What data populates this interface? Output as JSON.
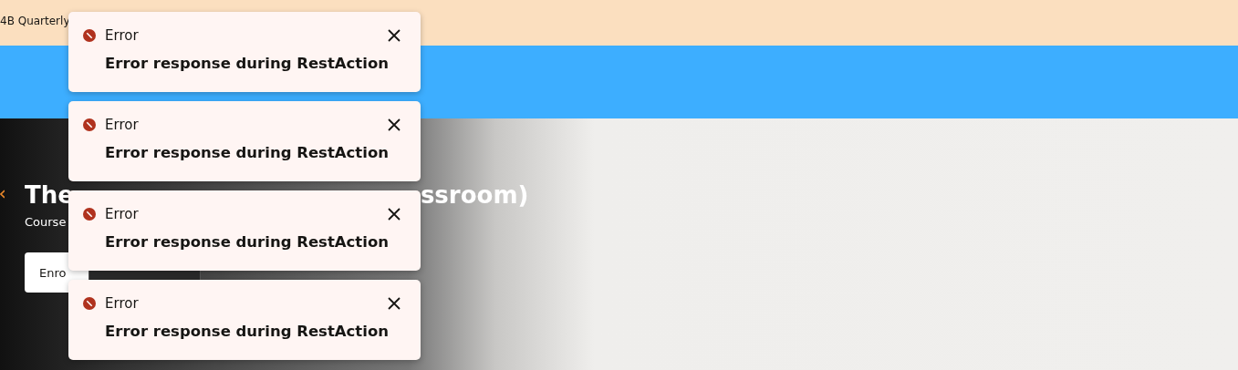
{
  "banner": {
    "text": "4B Quarterly"
  },
  "hero": {
    "title_start": "The",
    "title_end": "ssroom)",
    "subtitle": "Course",
    "button": "Enro"
  },
  "toasts": [
    {
      "title": "Error",
      "message": "Error response during RestAction"
    },
    {
      "title": "Error",
      "message": "Error response during RestAction"
    },
    {
      "title": "Error",
      "message": "Error response during RestAction"
    },
    {
      "title": "Error",
      "message": "Error response during RestAction"
    }
  ]
}
